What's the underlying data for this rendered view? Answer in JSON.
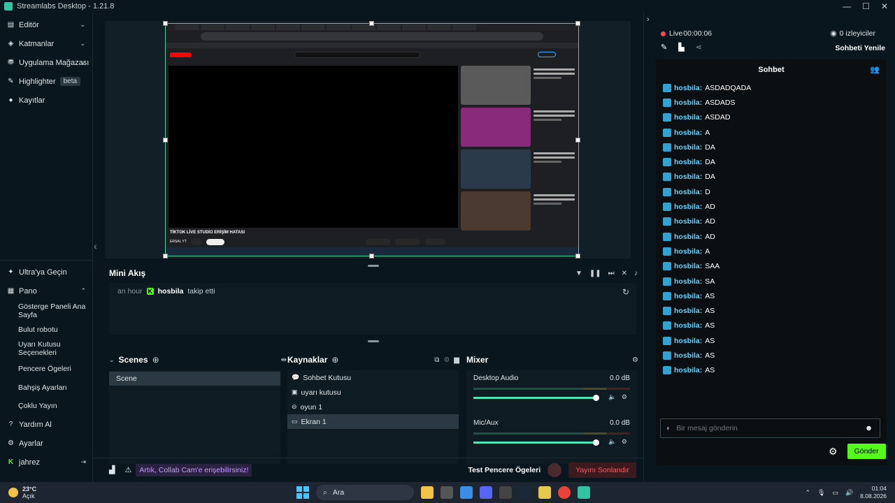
{
  "window": {
    "title": "Streamlabs Desktop - 1.21.8",
    "controls": [
      "—",
      "☐",
      "✕"
    ]
  },
  "nav": {
    "top_items": [
      {
        "label": "Editör",
        "icon": "editor-icon"
      },
      {
        "label": "Katmanlar",
        "icon": "layers-icon"
      },
      {
        "label": "Uygulama Mağazası",
        "icon": "app-store-icon"
      },
      {
        "label": "Highlighter",
        "badge": "beta",
        "icon": "highlighter-icon"
      },
      {
        "label": "Kayıtlar",
        "icon": "recordings-icon"
      }
    ],
    "ultra": "Ultra'ya Geçin",
    "pano": "Pano",
    "pano_items": [
      "Gösterge Paneli Ana Sayfa",
      "Bulut robotu",
      "Uyarı Kutusu Seçenekleri",
      "Pencere Ögeleri",
      "Bahşiş Ayarları",
      "Çoklu Yayın"
    ],
    "help": "Yardım Al",
    "settings": "Ayarlar",
    "user": "jahrez"
  },
  "preview": {
    "video_title": "TİKTOK LİVE STUDİO ERİŞİM HATASI",
    "channel": "ERSAL YT"
  },
  "mini_feed": {
    "title": "Mini Akış",
    "time": "an hour",
    "user": "hosbila",
    "action": "takip etti"
  },
  "scenes": {
    "title": "Scenes",
    "items": [
      "Scene"
    ]
  },
  "sources": {
    "title": "Kaynaklar",
    "items": [
      {
        "label": "Sohbet Kutusu",
        "icon": "chat-icon"
      },
      {
        "label": "uyarı kutusu",
        "icon": "alert-icon"
      },
      {
        "label": "oyun 1",
        "icon": "gamepad-icon"
      },
      {
        "label": "Ekran 1",
        "icon": "monitor-icon"
      }
    ]
  },
  "mixer": {
    "title": "Mixer",
    "channels": [
      {
        "name": "Desktop Audio",
        "level": "0.0 dB",
        "volume": 1.0
      },
      {
        "name": "Mic/Aux",
        "level": "0.0 dB",
        "volume": 1.0
      }
    ]
  },
  "footer": {
    "promo": "Artık, Collab Cam'e erişebilirsiniz!",
    "test": "Test Pencere Ögeleri",
    "end": "Yayını Sonlandır"
  },
  "live": {
    "status": "Live",
    "time": "00:00:06",
    "viewers": "0 izleyiciler",
    "refresh": "Sohbeti Yenile"
  },
  "chat": {
    "title": "Sohbet",
    "messages": [
      {
        "user": "hosbila:",
        "text": "ASDADQADA"
      },
      {
        "user": "hosbila:",
        "text": "ASDADS"
      },
      {
        "user": "hosbila:",
        "text": "ASDAD"
      },
      {
        "user": "hosbila:",
        "text": "A"
      },
      {
        "user": "hosbila:",
        "text": "DA"
      },
      {
        "user": "hosbila:",
        "text": "DA"
      },
      {
        "user": "hosbila:",
        "text": "DA"
      },
      {
        "user": "hosbila:",
        "text": "D"
      },
      {
        "user": "hosbila:",
        "text": "AD"
      },
      {
        "user": "hosbila:",
        "text": "AD"
      },
      {
        "user": "hosbila:",
        "text": "AD"
      },
      {
        "user": "hosbila:",
        "text": "A"
      },
      {
        "user": "hosbila:",
        "text": "SAA"
      },
      {
        "user": "hosbila:",
        "text": "SA"
      },
      {
        "user": "hosbila:",
        "text": "AS"
      },
      {
        "user": "hosbila:",
        "text": "AS"
      },
      {
        "user": "hosbila:",
        "text": "AS"
      },
      {
        "user": "hosbila:",
        "text": "AS"
      },
      {
        "user": "hosbila:",
        "text": "AS"
      },
      {
        "user": "hosbila:",
        "text": "AS"
      }
    ],
    "placeholder": "Bir mesaj gönderin",
    "send": "Gönder"
  },
  "taskbar": {
    "temp": "23°C",
    "weather": "Açık",
    "search": "Ara",
    "time": "01:04",
    "date": "8.08.2026"
  }
}
